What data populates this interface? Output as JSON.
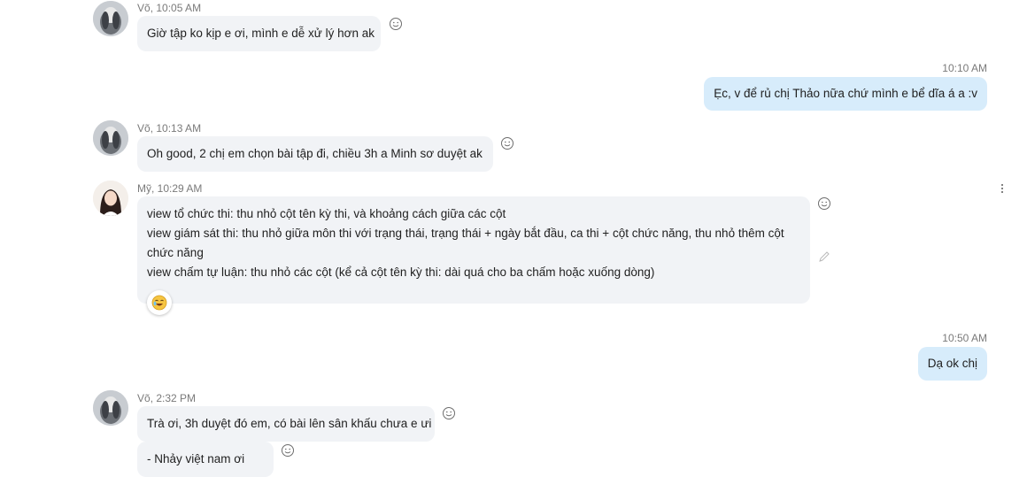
{
  "messages": [
    {
      "sender": "Võ",
      "time": "10:05 AM",
      "text": "Giờ tập ko kịp e ơi, mình e dễ xử lý hơn ak"
    },
    {
      "time": "10:10 AM",
      "text": "Ẹc, v để rủ chị Thảo nữa chứ mình e bể dĩa á a :v"
    },
    {
      "sender": "Võ",
      "time": "10:13 AM",
      "text": "Oh good, 2 chị em chọn bài tập đi, chiều 3h a Minh sơ duyệt ak"
    },
    {
      "sender": "Mỹ",
      "time": "10:29 AM",
      "lines": [
        "view tổ chức thi: thu nhỏ cột tên kỳ thi, và khoảng cách giữa các cột",
        "view giám sát thi: thu nhỏ giữa môn thi với trạng thái, trạng thái + ngày bắt đầu, ca thi + cột chức năng, thu nhỏ thêm cột",
        "chức năng",
        "view chấm tự luận: thu nhỏ các cột (kể cả cột tên kỳ thi: dài quá cho ba chấm hoặc xuống dòng)"
      ]
    },
    {
      "time": "10:50 AM",
      "text": "Dạ ok chị"
    },
    {
      "sender": "Võ",
      "time": "2:32 PM",
      "text": "Trà ơi, 3h duyệt đó em, có bài lên sân khấu chưa e ưi"
    },
    {
      "text": "- Nhảy việt nam ơi"
    }
  ],
  "icons": {
    "reaction": "smiley-face-icon",
    "edit": "pencil-icon",
    "more": "more-options-icon",
    "reaction_badge": "laughing-emoji-icon"
  }
}
